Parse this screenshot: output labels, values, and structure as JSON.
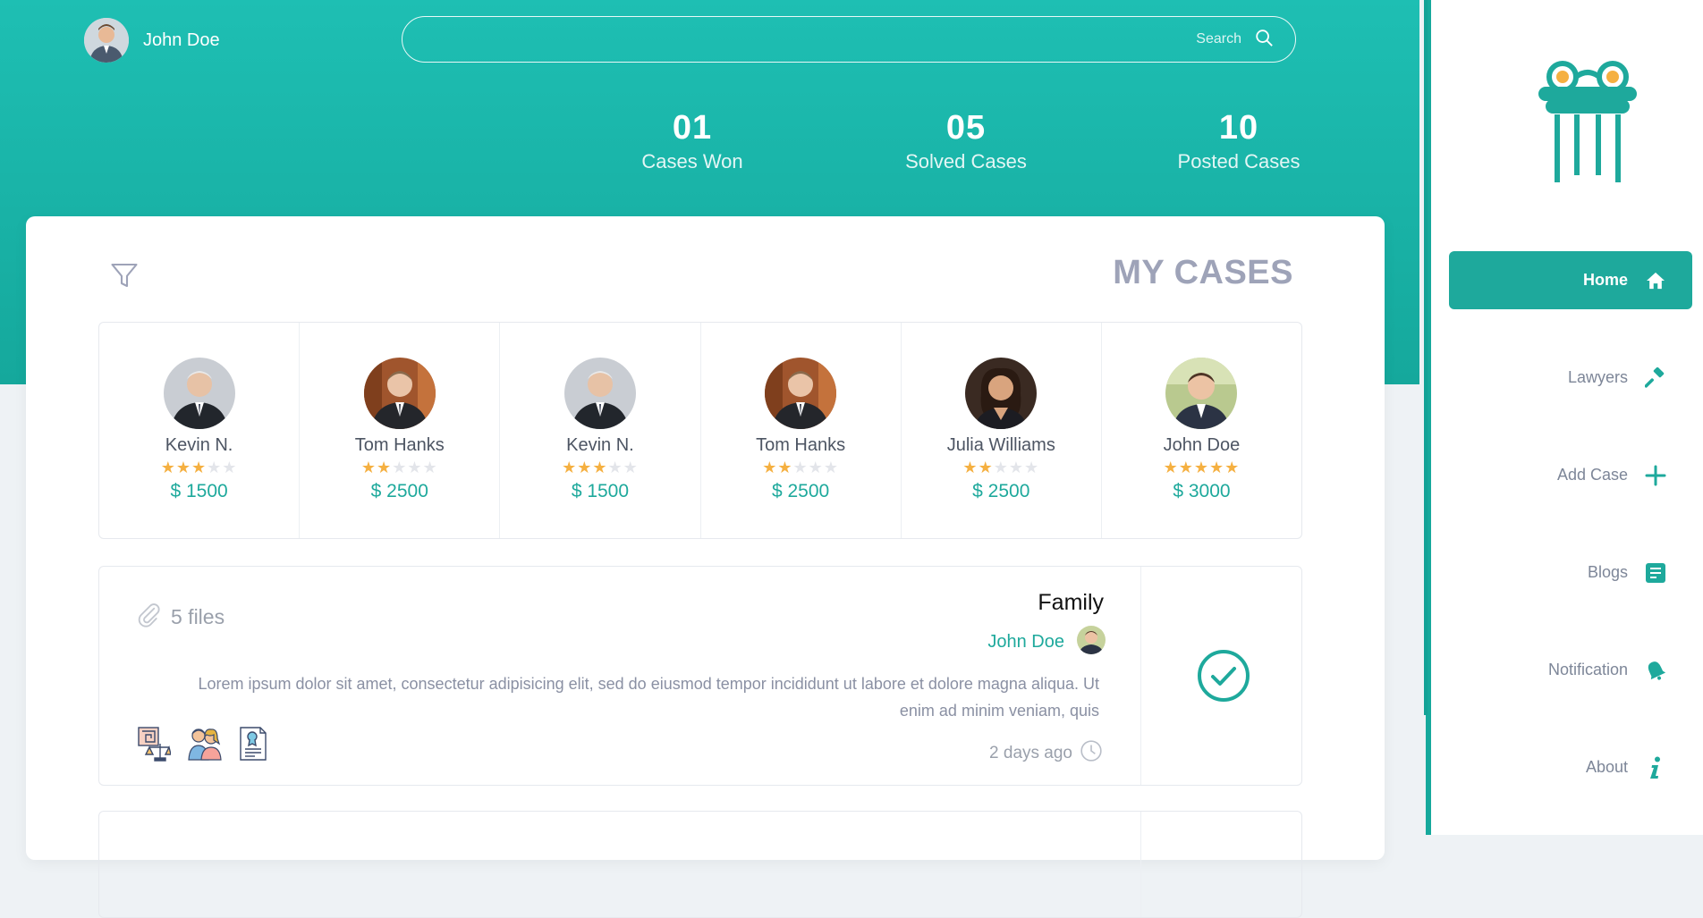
{
  "header": {
    "user_name": "John Doe",
    "search_placeholder": "Search"
  },
  "stats": [
    {
      "value": "01",
      "label": "Cases Won"
    },
    {
      "value": "05",
      "label": "Solved Cases"
    },
    {
      "value": "10",
      "label": "Posted Cases"
    }
  ],
  "main": {
    "title": "MY CASES",
    "lawyers": [
      {
        "name": "Kevin N.",
        "rating": 3,
        "max_rating": 5,
        "price": "$ 1500"
      },
      {
        "name": "Tom Hanks",
        "rating": 2,
        "max_rating": 5,
        "price": "$ 2500"
      },
      {
        "name": "Kevin N.",
        "rating": 3,
        "max_rating": 5,
        "price": "$ 1500"
      },
      {
        "name": "Tom Hanks",
        "rating": 2,
        "max_rating": 5,
        "price": "$ 2500"
      },
      {
        "name": "Julia Williams",
        "rating": 2,
        "max_rating": 5,
        "price": "$ 2500"
      },
      {
        "name": "John Doe",
        "rating": 5,
        "max_rating": 5,
        "price": "$ 3000"
      }
    ],
    "case": {
      "files": "5 files",
      "type": "Family",
      "owner": "John Doe",
      "description": "Lorem ipsum dolor sit amet, consectetur adipisicing elit, sed do eiusmod tempor incididunt ut labore et dolore magna aliqua. Ut enim ad minim veniam, quis",
      "time": "2 days ago",
      "category_icons": [
        "law-maze-icon",
        "family-icon",
        "certificate-icon"
      ]
    }
  },
  "sidebar": {
    "items": [
      {
        "label": "Home",
        "icon": "home-icon",
        "active": true
      },
      {
        "label": "Lawyers",
        "icon": "gavel-icon",
        "active": false
      },
      {
        "label": "Add Case",
        "icon": "plus-icon",
        "active": false
      },
      {
        "label": "Blogs",
        "icon": "document-icon",
        "active": false
      },
      {
        "label": "Notification",
        "icon": "bell-icon",
        "active": false
      },
      {
        "label": "About",
        "icon": "info-icon",
        "active": false
      }
    ]
  },
  "colors": {
    "brand_teal": "#1ea99c",
    "star": "#f5b041",
    "title_grey": "#9ea3b8"
  }
}
